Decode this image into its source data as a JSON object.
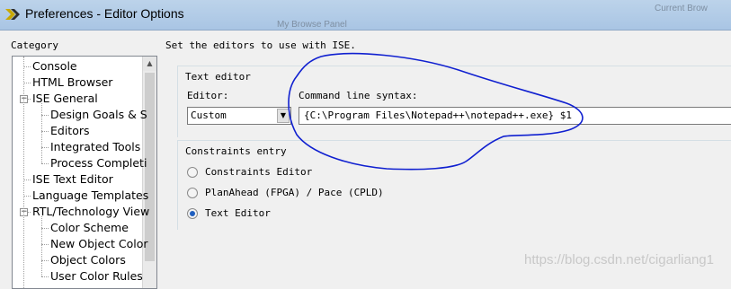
{
  "window": {
    "title": "Preferences - Editor Options",
    "background_texts": [
      "Current Brow",
      "My Browse Panel"
    ]
  },
  "category": {
    "label": "Category",
    "items": [
      {
        "label": "Console",
        "level": 1,
        "expander": ""
      },
      {
        "label": "HTML Browser",
        "level": 1,
        "expander": ""
      },
      {
        "label": "ISE General",
        "level": 1,
        "expander": "−"
      },
      {
        "label": "Design Goals & S",
        "level": 2,
        "expander": ""
      },
      {
        "label": "Editors",
        "level": 2,
        "expander": ""
      },
      {
        "label": "Integrated Tools",
        "level": 2,
        "expander": ""
      },
      {
        "label": "Process Completi",
        "level": 2,
        "expander": ""
      },
      {
        "label": "ISE Text Editor",
        "level": 1,
        "expander": ""
      },
      {
        "label": "Language Templates",
        "level": 1,
        "expander": ""
      },
      {
        "label": "RTL/Technology View",
        "level": 1,
        "expander": "−"
      },
      {
        "label": "Color Scheme",
        "level": 2,
        "expander": ""
      },
      {
        "label": "New Object Color",
        "level": 2,
        "expander": ""
      },
      {
        "label": "Object Colors",
        "level": 2,
        "expander": ""
      },
      {
        "label": "User Color Rules",
        "level": 2,
        "expander": ""
      }
    ]
  },
  "main": {
    "instruction": "Set the editors to use with ISE.",
    "text_editor_group": {
      "title": "Text editor",
      "editor_label": "Editor:",
      "editor_value": "Custom",
      "cmd_label": "Command line syntax:",
      "cmd_value": "{C:\\Program Files\\Notepad++\\notepad++.exe} $1"
    },
    "constraints_group": {
      "title": "Constraints entry",
      "options": [
        {
          "label": "Constraints Editor",
          "checked": false
        },
        {
          "label": "PlanAhead (FPGA) / Pace (CPLD)",
          "checked": false
        },
        {
          "label": "Text Editor",
          "checked": true
        }
      ]
    }
  },
  "watermark": "https://blog.csdn.net/cigarliang1",
  "colors": {
    "annotation_stroke": "#1020d0",
    "radio_accent": "#1f5fbf"
  }
}
